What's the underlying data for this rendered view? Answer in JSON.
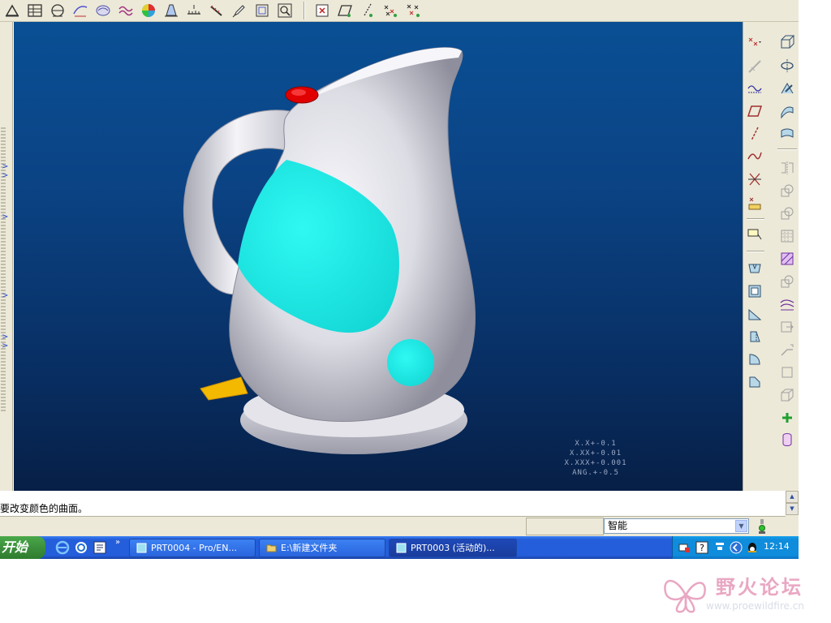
{
  "top_toolbar": {
    "icons": [
      "triangle-icon",
      "table-icon",
      "section-icon",
      "curve-analysis-icon",
      "surface-analysis-icon",
      "wave-icon",
      "color-map-icon",
      "draft-icon",
      "measure-icon",
      "ruler-icon",
      "pen-icon",
      "zoom-box-icon",
      "zoom-fit-icon",
      "close-box-icon",
      "plane-view-icon",
      "axis-view-icon",
      "point-view-icon",
      "coord-view-icon"
    ]
  },
  "viewport": {
    "tolerance_lines": [
      "X.X+-0.1",
      "X.XX+-0.01",
      "X.XXX+-0.001",
      "ANG.+-0.5"
    ],
    "colors": {
      "bg_top": "#0a4f94",
      "bg_bottom": "#071f46",
      "kettle_body": "#e6e6ec",
      "window_accent": "#19f0ee",
      "button_red": "#e00000",
      "trigger_yellow": "#f3b900"
    }
  },
  "message_area": {
    "text": "要改变颜色的曲面。"
  },
  "status_bar": {
    "filter_value": "智能"
  },
  "taskbar": {
    "start_label": "开始",
    "buttons": [
      {
        "label": "PRT0004 - Pro/EN..."
      },
      {
        "label": "E:\\新建文件夹"
      },
      {
        "label": "PRT0003 (活动的)..."
      }
    ],
    "clock": "12:14"
  },
  "watermark": {
    "title": "野火论坛",
    "url": "www.proewildfire.cn"
  }
}
